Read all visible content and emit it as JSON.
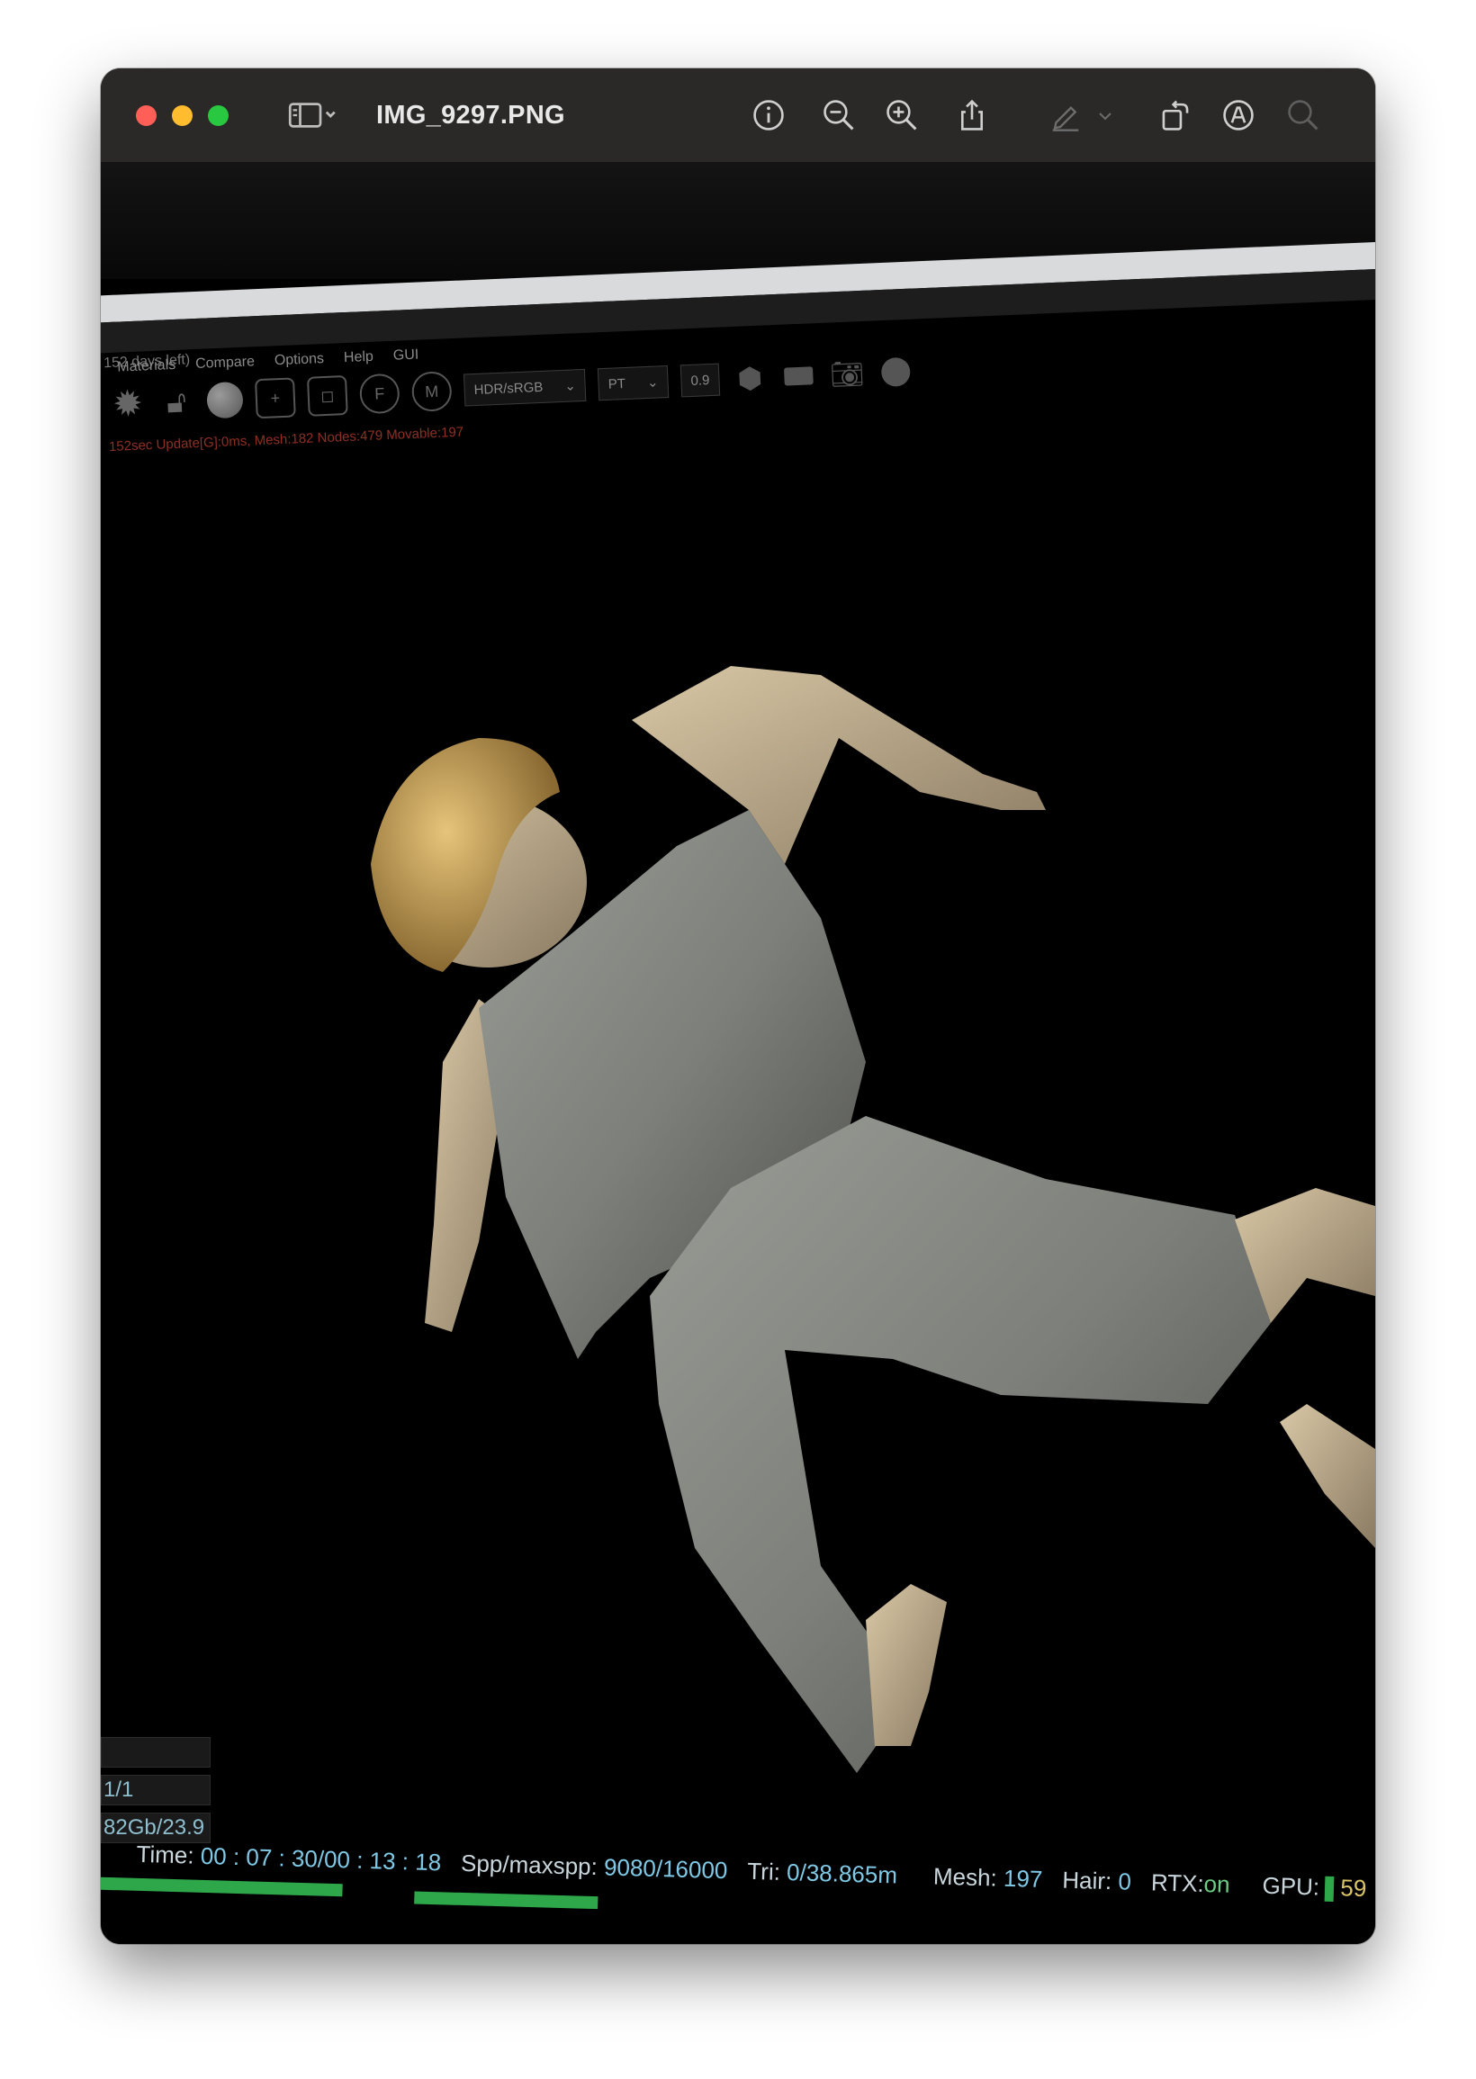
{
  "window": {
    "title": "IMG_9297.PNG",
    "icons": {
      "sidebar": "sidebar-icon",
      "info": "info-icon",
      "zoom_out": "zoom-out-icon",
      "zoom_in": "zoom-in-icon",
      "share": "share-icon",
      "markup": "pencil-icon",
      "rotate": "rotate-icon",
      "annotate": "markup-circle-icon",
      "search": "search-icon"
    }
  },
  "render_app": {
    "trial_text": "152 days left)",
    "menu": [
      "Materials",
      "Compare",
      "Options",
      "Help",
      "GUI"
    ],
    "tone_select": "HDR/sRGB",
    "mode_select": "PT",
    "value_field": "0.9",
    "status_line": "152sec Update[G]:0ms, Mesh:182 Nodes:479 Movable:197",
    "left_panel": [
      "",
      "1/1",
      "82Gb/23.9"
    ],
    "hud": {
      "time_label": "Time:",
      "time_value": "00 : 07 : 30/00 : 13 : 18",
      "spp_label": "Spp/maxspp:",
      "spp_value": "9080/16000",
      "tri_label": "Tri:",
      "tri_value": "0/38.865m",
      "mesh_label": "Mesh:",
      "mesh_value": "197",
      "hair_label": "Hair:",
      "hair_value": "0",
      "rtx_label": "RTX:",
      "rtx_value": "on",
      "gpu_label": "GPU:",
      "gpu_value": "59"
    },
    "progress_fraction": 0.5675
  }
}
